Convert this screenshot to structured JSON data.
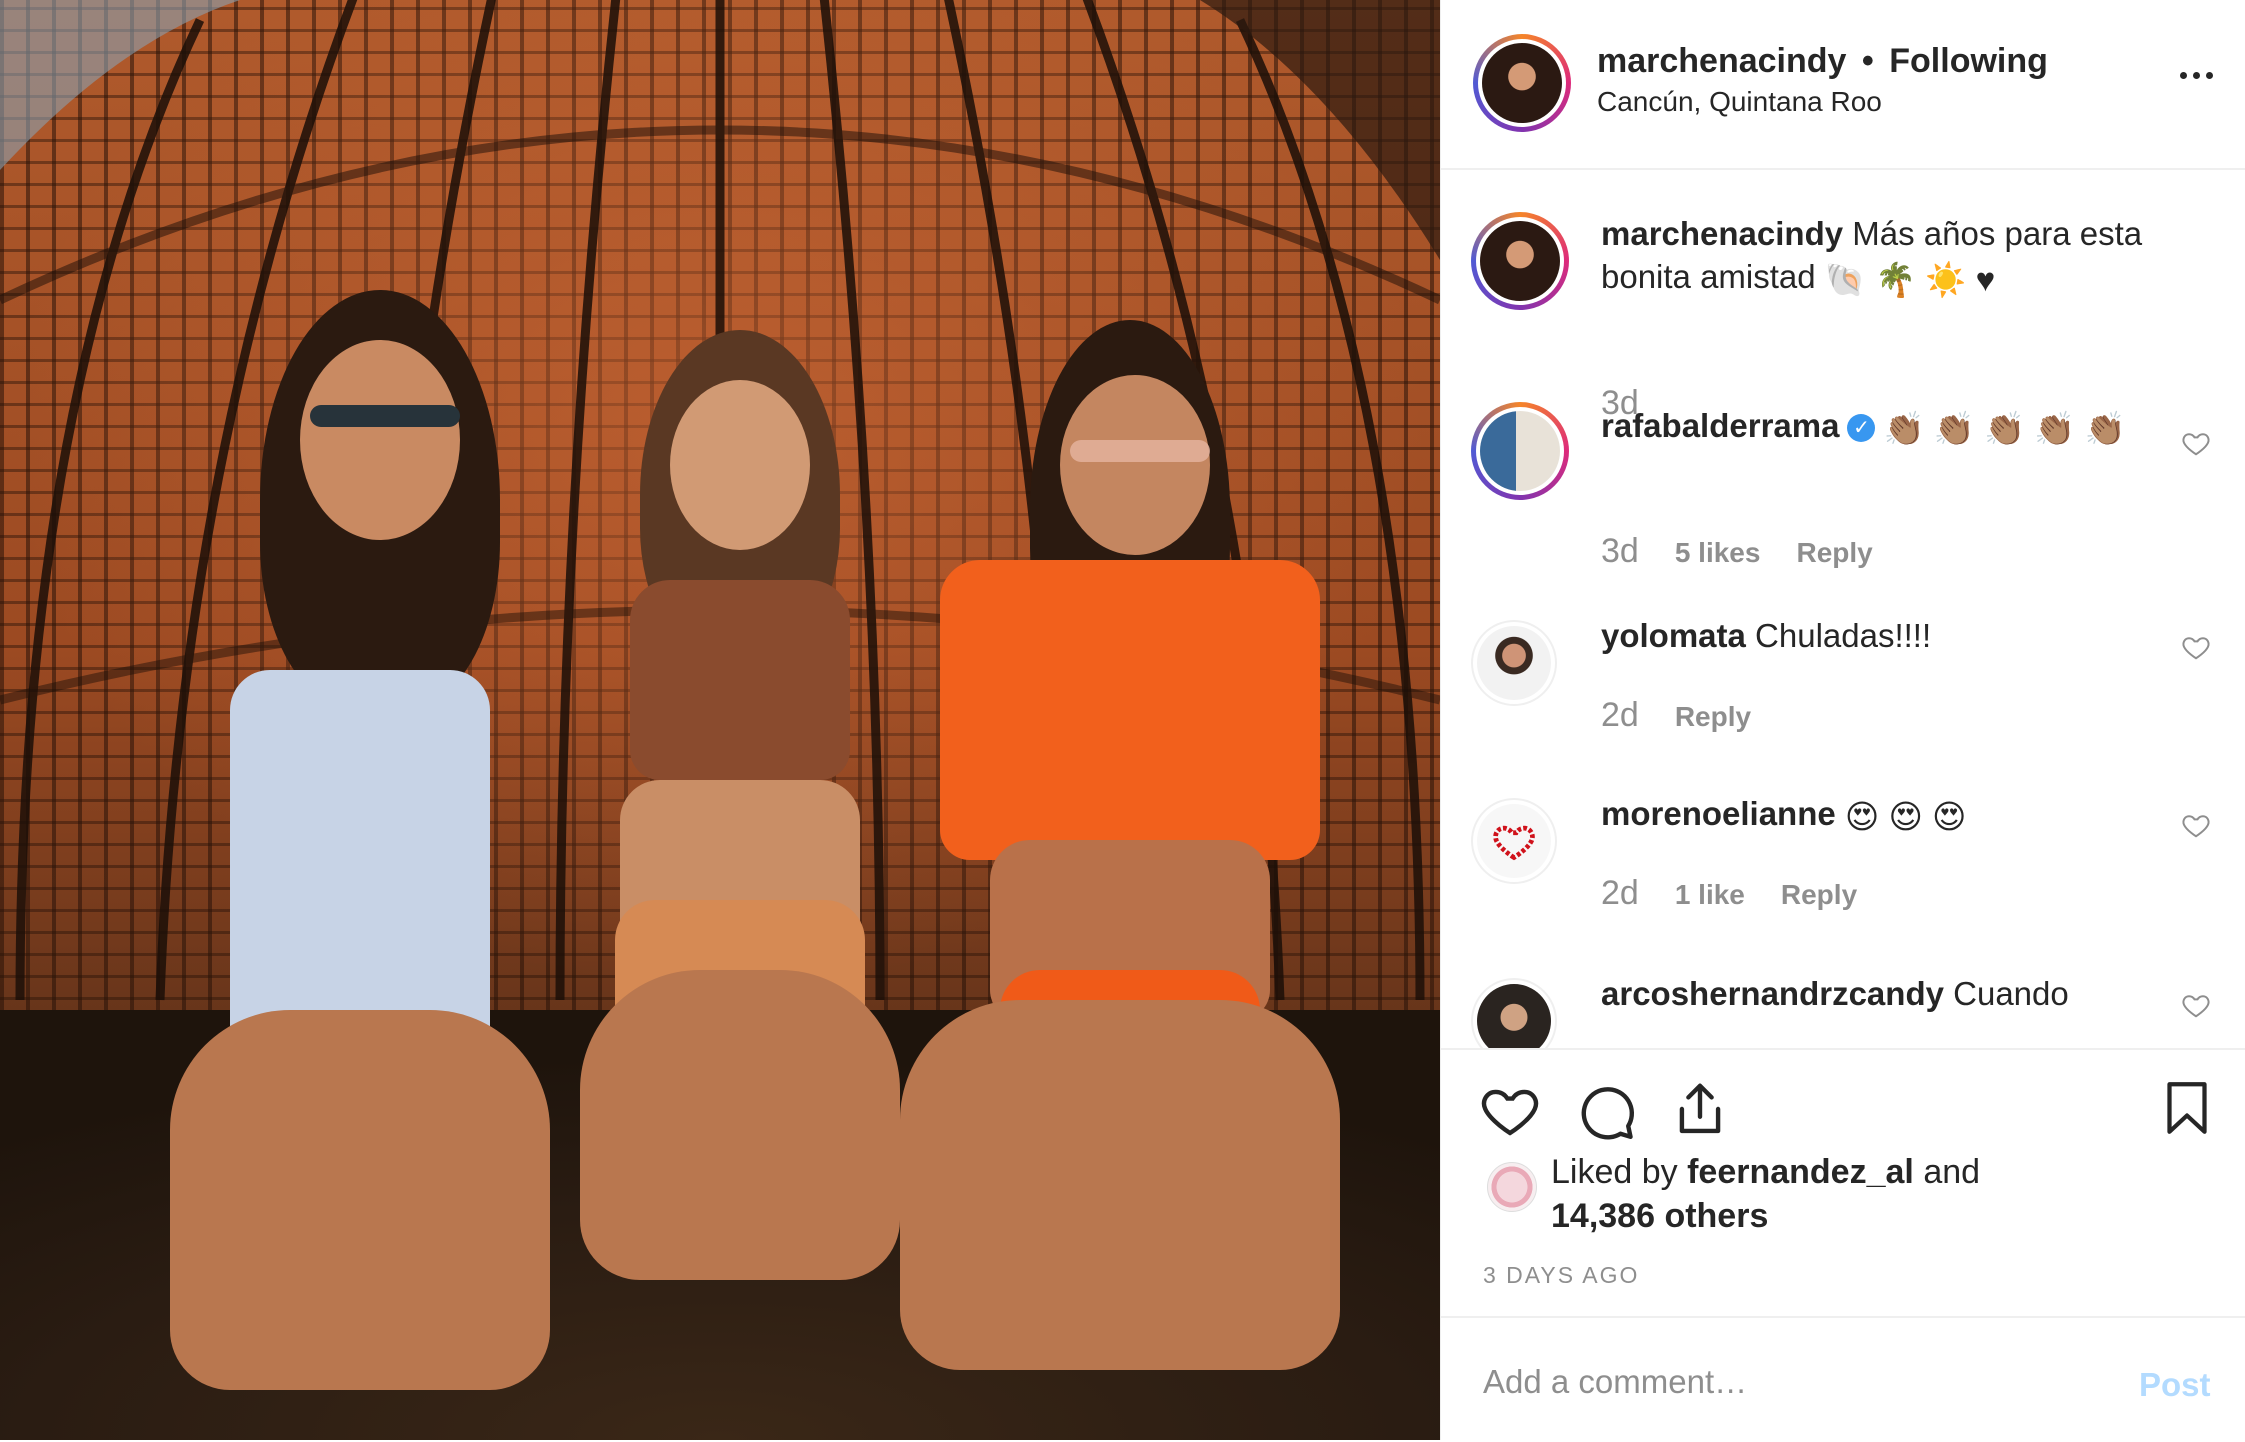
{
  "post": {
    "author": "marchenacindy",
    "follow_status": "Following",
    "separator": "•",
    "location": "Cancún, Quintana Roo"
  },
  "caption": {
    "author": "marchenacindy",
    "text": "Más años para esta bonita amistad",
    "emojis": "🐚 🌴 ☀️ ♥",
    "time": "3d"
  },
  "comments": [
    {
      "username": "rafabalderrama",
      "verified": true,
      "text": "👏🏽 👏🏽 👏🏽 👏🏽 👏🏽",
      "time": "3d",
      "likes": "5 likes",
      "reply_label": "Reply"
    },
    {
      "username": "yolomata",
      "verified": false,
      "text": "Chuladas!!!!",
      "time": "2d",
      "likes": "",
      "reply_label": "Reply"
    },
    {
      "username": "morenoelianne",
      "verified": false,
      "text": "😍 😍 😍",
      "time": "2d",
      "likes": "1 like",
      "reply_label": "Reply"
    },
    {
      "username": "arcoshernandrzcandy",
      "verified": false,
      "text": "Cuando",
      "time": "",
      "likes": "",
      "reply_label": ""
    }
  ],
  "likes": {
    "prefix": "Liked by",
    "user": "feernandez_al",
    "conjunction": "and",
    "others": "14,386 others"
  },
  "timestamp": "3 DAYS AGO",
  "add_comment": {
    "placeholder": "Add a comment…",
    "post_label": "Post"
  },
  "icons": {
    "more": "more-options-icon",
    "like": "heart-icon",
    "comment": "comment-bubble-icon",
    "share": "share-icon",
    "save": "bookmark-icon"
  },
  "colors": {
    "text": "#262626",
    "muted": "#8e8e8e",
    "verified": "#3897f0",
    "post_button_disabled": "#b3dbff",
    "divider": "#efefef"
  }
}
